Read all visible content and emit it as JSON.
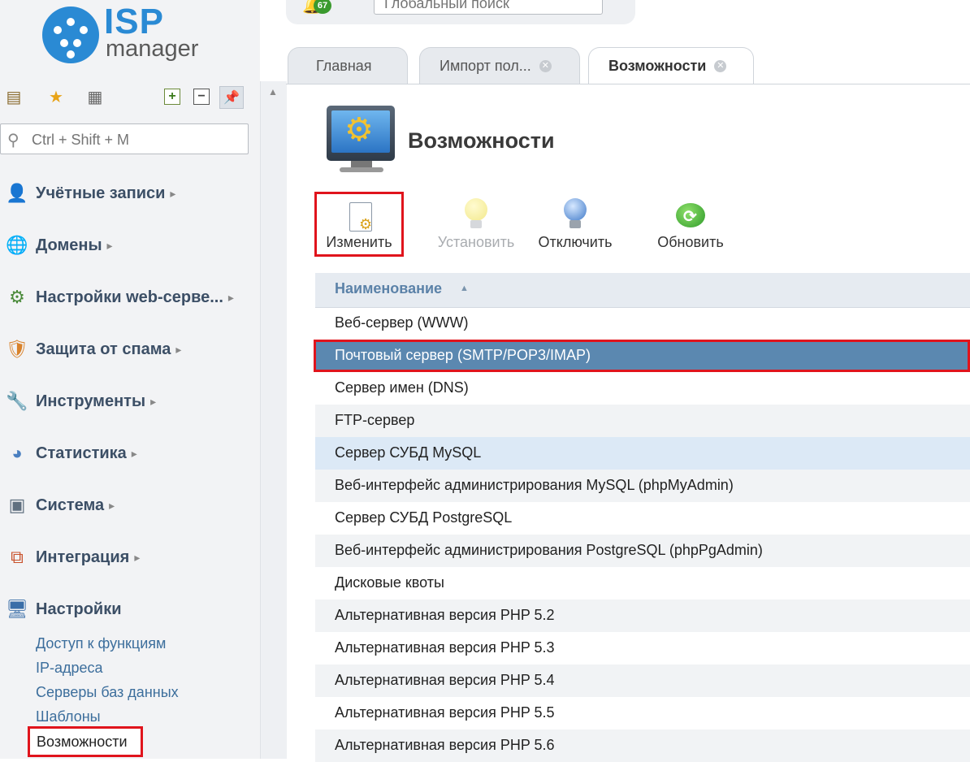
{
  "app": {
    "logo_main": "ISP",
    "logo_sub": "manager",
    "notifications_count": "67",
    "global_search_placeholder": "Глобальный поиск"
  },
  "sidebar": {
    "search_placeholder": "Ctrl + Shift + M",
    "items": [
      {
        "label": "Учётные записи",
        "icon": "user-accounts-icon"
      },
      {
        "label": "Домены",
        "icon": "globe-icon"
      },
      {
        "label": "Настройки web-серве...",
        "icon": "web-settings-icon"
      },
      {
        "label": "Защита от спама",
        "icon": "spam-shield-icon"
      },
      {
        "label": "Инструменты",
        "icon": "tools-icon"
      },
      {
        "label": "Статистика",
        "icon": "pie-chart-icon"
      },
      {
        "label": "Система",
        "icon": "system-icon"
      },
      {
        "label": "Интеграция",
        "icon": "integration-icon"
      },
      {
        "label": "Настройки",
        "icon": "settings-monitor-icon"
      }
    ],
    "settings_subitems": [
      "Доступ к функциям",
      "IP-адреса",
      "Серверы баз данных",
      "Шаблоны",
      "Возможности"
    ]
  },
  "tabs": [
    {
      "label": "Главная",
      "closable": false
    },
    {
      "label": "Импорт пол...",
      "closable": true
    },
    {
      "label": "Возможности",
      "closable": true,
      "active": true
    }
  ],
  "page": {
    "title": "Возможности"
  },
  "actions": [
    {
      "label": "Изменить",
      "enabled": true
    },
    {
      "label": "Установить",
      "enabled": false
    },
    {
      "label": "Отключить",
      "enabled": true
    },
    {
      "label": "Обновить",
      "enabled": true
    }
  ],
  "table": {
    "column_header": "Наименование",
    "sort": "ascending",
    "rows": [
      "Веб-сервер (WWW)",
      "Почтовый сервер (SMTP/POP3/IMAP)",
      "Сервер имен (DNS)",
      "FTP-сервер",
      "Сервер СУБД MySQL",
      "Веб-интерфейс администрирования MySQL (phpMyAdmin)",
      "Сервер СУБД PostgreSQL",
      "Веб-интерфейс администрирования PostgreSQL (phpPgAdmin)",
      "Дисковые квоты",
      "Альтернативная версия PHP 5.2",
      "Альтернативная версия PHP 5.3",
      "Альтернативная версия PHP 5.4",
      "Альтернативная версия PHP 5.5",
      "Альтернативная версия PHP 5.6"
    ],
    "selected_row": "Почтовый сервер (SMTP/POP3/IMAP)",
    "hover_row": "Сервер СУБД MySQL"
  },
  "colors": {
    "accent_blue": "#2a8ad4",
    "selected_row": "#5b88b0",
    "highlight_red": "#e0141c",
    "nav_text": "#3c4f66"
  }
}
